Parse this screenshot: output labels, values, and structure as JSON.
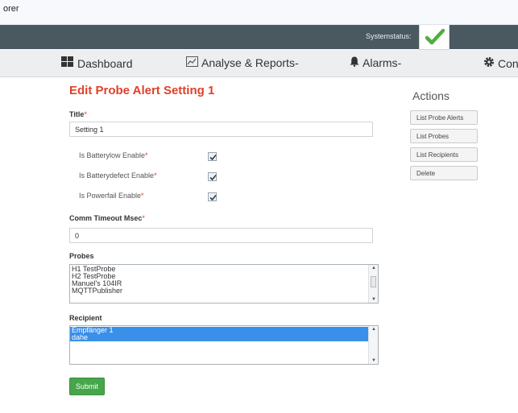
{
  "window": {
    "title_fragment": "orer"
  },
  "topbar": {
    "status_label": "Systemstatus:",
    "status": "ok"
  },
  "nav": {
    "items": [
      {
        "label": "Dashboard",
        "icon": "dashboard-grid-icon"
      },
      {
        "label": "Analyse & Reports",
        "icon": "chart-icon",
        "suffix": "-"
      },
      {
        "label": "Alarms",
        "icon": "bell-icon",
        "suffix": "-"
      },
      {
        "label": "Con",
        "icon": "gear-icon"
      }
    ]
  },
  "form": {
    "heading": "Edit Probe Alert Setting 1",
    "title_label": "Title",
    "required_mark": "*",
    "title_value": "Setting 1",
    "checkboxes": [
      {
        "label": "Is Batterylow Enable",
        "checked": true
      },
      {
        "label": "Is Batterydefect Enable",
        "checked": true
      },
      {
        "label": "Is Powerfail Enable",
        "checked": true
      }
    ],
    "timeout_label": "Comm Timeout Msec",
    "timeout_value": "0",
    "probes_label": "Probes",
    "probes": [
      "H1 TestProbe",
      "H2 TestProbe",
      "Manuel's 104IR",
      "MQTTPublisher"
    ],
    "recipient_label": "Recipient",
    "recipients": [
      {
        "label": "Empfänger 1",
        "selected": true
      },
      {
        "label": "dahe",
        "selected": true
      }
    ],
    "submit_label": "Submit"
  },
  "actions": {
    "title": "Actions",
    "buttons": [
      "List Probe Alerts",
      "List Probes",
      "List Recipients",
      "Delete"
    ]
  },
  "colors": {
    "accent": "#e0402a",
    "submit": "#48a64a",
    "selection": "#3a8fe8",
    "topbar": "#4a5860"
  }
}
